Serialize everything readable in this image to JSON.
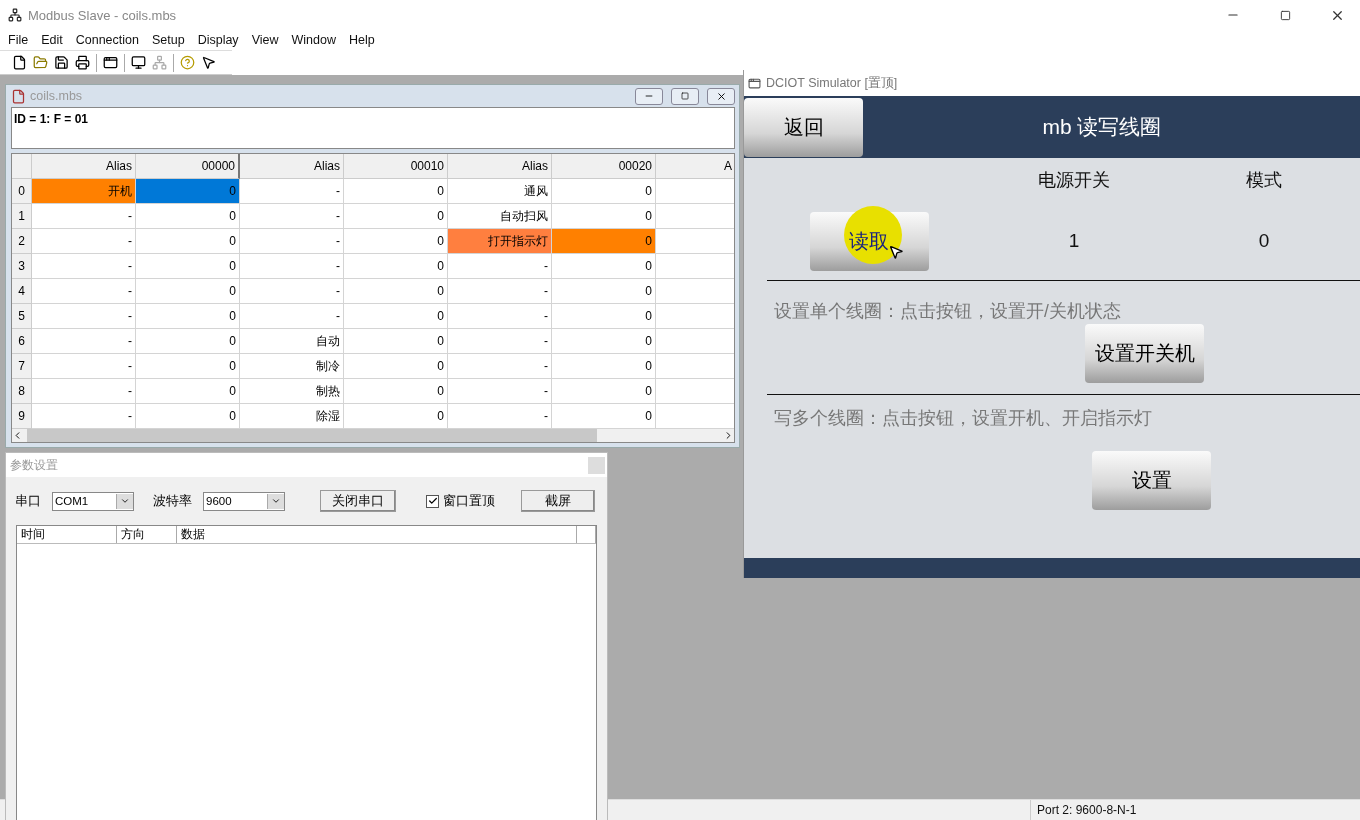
{
  "app": {
    "title": "Modbus Slave - coils.mbs",
    "menu": [
      "File",
      "Edit",
      "Connection",
      "Setup",
      "Display",
      "View",
      "Window",
      "Help"
    ],
    "toolbar": [
      {
        "kind": "new",
        "disabled": false
      },
      {
        "kind": "open",
        "disabled": false
      },
      {
        "kind": "save",
        "disabled": false
      },
      {
        "kind": "print",
        "disabled": false
      },
      {
        "kind": "separator"
      },
      {
        "kind": "window",
        "disabled": false
      },
      {
        "kind": "separator"
      },
      {
        "kind": "connect",
        "disabled": false
      },
      {
        "kind": "disconnect",
        "disabled": true
      },
      {
        "kind": "separator"
      },
      {
        "kind": "help",
        "disabled": false
      },
      {
        "kind": "context-help",
        "disabled": false
      }
    ],
    "status": "Port 2: 9600-8-N-1"
  },
  "doc": {
    "title": "coils.mbs",
    "info": "ID = 1: F = 01",
    "columns": [
      "Alias",
      "00000",
      "Alias",
      "00010",
      "Alias",
      "00020",
      "A"
    ],
    "rows": [
      {
        "label": "0",
        "cells": [
          {
            "text": "开机",
            "color": "#ff8000"
          },
          {
            "text": "0",
            "color": "#0078d7"
          },
          {
            "text": "-"
          },
          {
            "text": "0"
          },
          {
            "text": "通风"
          },
          {
            "text": "0"
          }
        ]
      },
      {
        "label": "1",
        "cells": [
          {
            "text": "-"
          },
          {
            "text": "0"
          },
          {
            "text": "-"
          },
          {
            "text": "0"
          },
          {
            "text": "自动扫风"
          },
          {
            "text": "0"
          }
        ]
      },
      {
        "label": "2",
        "cells": [
          {
            "text": "-"
          },
          {
            "text": "0"
          },
          {
            "text": "-"
          },
          {
            "text": "0"
          },
          {
            "text": "打开指示灯",
            "color": "#ff7f3f"
          },
          {
            "text": "0",
            "color": "#ff8000"
          }
        ]
      },
      {
        "label": "3",
        "cells": [
          {
            "text": "-"
          },
          {
            "text": "0"
          },
          {
            "text": "-"
          },
          {
            "text": "0"
          },
          {
            "text": "-"
          },
          {
            "text": "0"
          }
        ]
      },
      {
        "label": "4",
        "cells": [
          {
            "text": "-"
          },
          {
            "text": "0"
          },
          {
            "text": "-"
          },
          {
            "text": "0"
          },
          {
            "text": "-"
          },
          {
            "text": "0"
          }
        ]
      },
      {
        "label": "5",
        "cells": [
          {
            "text": "-"
          },
          {
            "text": "0"
          },
          {
            "text": "-"
          },
          {
            "text": "0"
          },
          {
            "text": "-"
          },
          {
            "text": "0"
          }
        ]
      },
      {
        "label": "6",
        "cells": [
          {
            "text": "-"
          },
          {
            "text": "0"
          },
          {
            "text": "自动"
          },
          {
            "text": "0"
          },
          {
            "text": "-"
          },
          {
            "text": "0"
          }
        ]
      },
      {
        "label": "7",
        "cells": [
          {
            "text": "-"
          },
          {
            "text": "0"
          },
          {
            "text": "制冷"
          },
          {
            "text": "0"
          },
          {
            "text": "-"
          },
          {
            "text": "0"
          }
        ]
      },
      {
        "label": "8",
        "cells": [
          {
            "text": "-"
          },
          {
            "text": "0"
          },
          {
            "text": "制热"
          },
          {
            "text": "0"
          },
          {
            "text": "-"
          },
          {
            "text": "0"
          }
        ]
      },
      {
        "label": "9",
        "cells": [
          {
            "text": "-"
          },
          {
            "text": "0"
          },
          {
            "text": "除湿"
          },
          {
            "text": "0"
          },
          {
            "text": "-"
          },
          {
            "text": "0"
          }
        ]
      }
    ]
  },
  "params": {
    "title": "参数设置",
    "port_label": "串口",
    "port": "COM1",
    "baud_label": "波特率",
    "baud": "9600",
    "close_button": "关闭串口",
    "topmost": {
      "label": "窗口置顶",
      "checked": true
    },
    "capture_button": "截屏",
    "log_columns": [
      "时间",
      "方向",
      "数据"
    ]
  },
  "sim": {
    "title": "DCIOT Simulator [置顶]",
    "back": "返回",
    "heading": "mb 读写线圈",
    "col_headers": [
      "电源开关",
      "模式"
    ],
    "read_button": "读取",
    "values": [
      "1",
      "0"
    ],
    "section1": "设置单个线圈：点击按钮，设置开/关机状态",
    "button1": "设置开关机",
    "section2": "写多个线圈：点击按钮，设置开机、开启指示灯",
    "button2": "设置"
  }
}
